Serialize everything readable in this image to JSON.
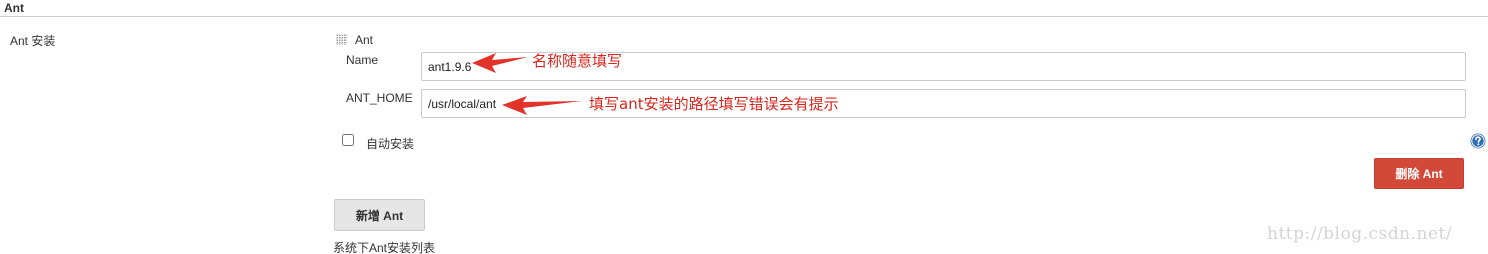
{
  "section": {
    "title": "Ant"
  },
  "field": {
    "label": "Ant 安装"
  },
  "installation": {
    "title": "Ant",
    "name_label": "Name",
    "name_value": "ant1.9.6",
    "home_label": "ANT_HOME",
    "home_value": "/usr/local/ant",
    "auto_install_label": "自动安装",
    "auto_install_checked": false,
    "delete_label": "删除 Ant"
  },
  "annotations": {
    "name_note": "名称随意填写",
    "home_note": "填写ant安装的路径填写错误会有提示",
    "color": "#d9261c"
  },
  "add_button_label": "新增 Ant",
  "description": "系统下Ant安装列表",
  "help_icon": "question-icon",
  "watermark": "http://blog.csdn.net/",
  "colors": {
    "delete_button": "#d24939",
    "add_button": "#e6e6e6",
    "help_icon": "#2f6db5"
  }
}
